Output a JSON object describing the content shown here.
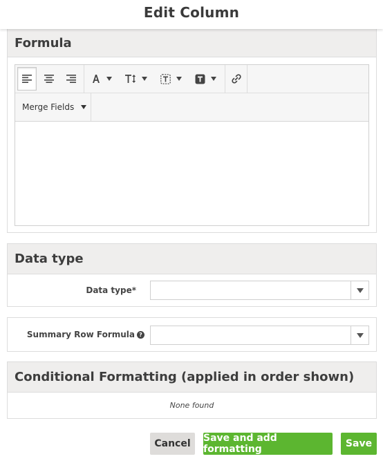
{
  "dialog": {
    "title": "Edit Column"
  },
  "formula": {
    "heading": "Formula",
    "toolbar": {
      "icons": [
        "align-left-icon",
        "align-center-icon",
        "align-right-icon",
        "font-color-icon",
        "font-size-icon",
        "text-box-icon",
        "text-style-icon",
        "link-icon"
      ],
      "merge_fields_label": "Merge Fields"
    },
    "content": ""
  },
  "data_type": {
    "heading": "Data type",
    "field_label": "Data type*",
    "value": ""
  },
  "summary": {
    "field_label": "Summary Row Formula",
    "help_icon": "question-circle-icon",
    "value": ""
  },
  "conditional_formatting": {
    "heading": "Conditional Formatting (applied in order shown)",
    "empty_text": "None found"
  },
  "buttons": {
    "cancel": "Cancel",
    "save_and_format": "Save and add formatting",
    "save": "Save"
  },
  "colors": {
    "primary_button": "#5cb630",
    "secondary_button": "#dedcda",
    "panel_header_bg": "#efeeed"
  }
}
